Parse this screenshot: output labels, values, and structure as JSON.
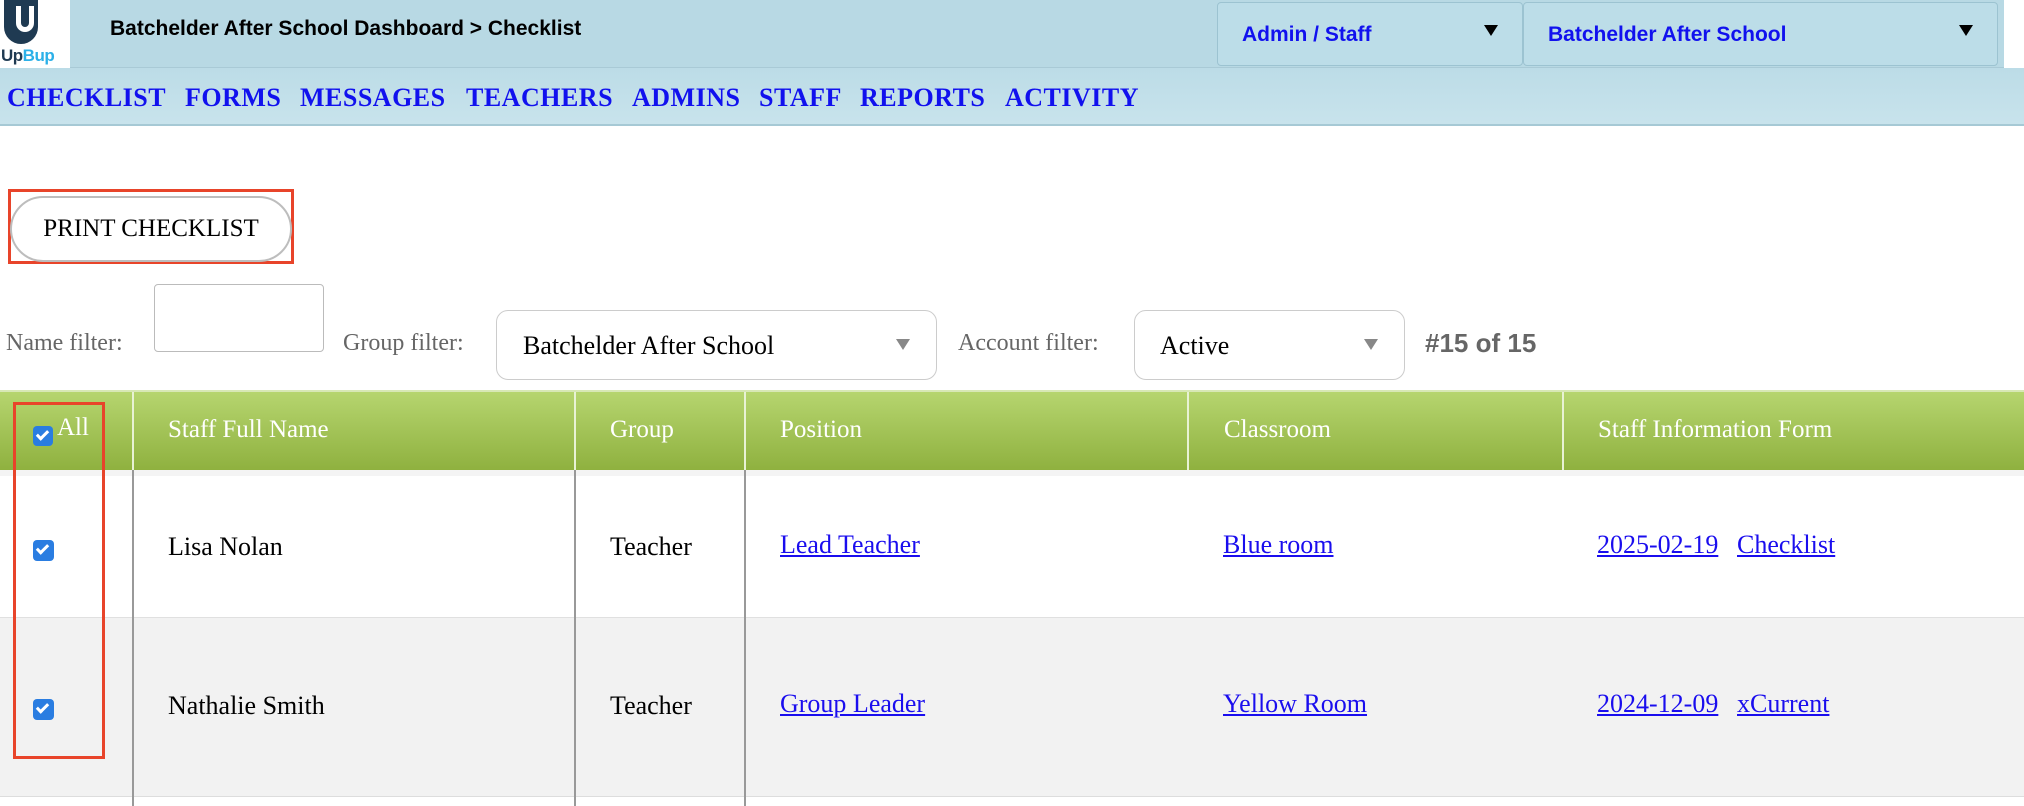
{
  "header": {
    "logo_text_1": "Up",
    "logo_text_2": "Bup",
    "breadcrumb": "Batchelder After School Dashboard > Checklist",
    "role_select": "Admin / Staff",
    "school_select": "Batchelder After School"
  },
  "nav": {
    "items": [
      "CHECKLIST",
      "FORMS",
      "MESSAGES",
      "TEACHERS",
      "ADMINS",
      "STAFF",
      "REPORTS",
      "ACTIVITY"
    ]
  },
  "actions": {
    "print_label": "PRINT CHECKLIST"
  },
  "filters": {
    "name_label": "Name filter:",
    "name_value": "",
    "group_label": "Group filter:",
    "group_value": "Batchelder After School",
    "account_label": "Account filter:",
    "account_value": "Active",
    "count": "#15 of 15"
  },
  "table": {
    "all_label": "All",
    "all_checked": true,
    "columns": [
      "Staff Full Name",
      "Group",
      "Position",
      "Classroom",
      "Staff Information Form"
    ],
    "rows": [
      {
        "checked": true,
        "name": "Lisa Nolan",
        "group": "Teacher",
        "position": "Lead Teacher",
        "classroom": "Blue room",
        "form_date": "2025-02-19",
        "form_link": "Checklist"
      },
      {
        "checked": true,
        "name": "Nathalie Smith",
        "group": "Teacher",
        "position": "Group Leader",
        "classroom": "Yellow Room",
        "form_date": "2024-12-09",
        "form_link": "xCurrent"
      }
    ]
  },
  "colors": {
    "header_bg": "#b8d9e4",
    "nav_link": "#1111ee",
    "table_header": "#9dbd4e",
    "highlight": "#e8442a",
    "checkbox": "#2a7de1"
  }
}
